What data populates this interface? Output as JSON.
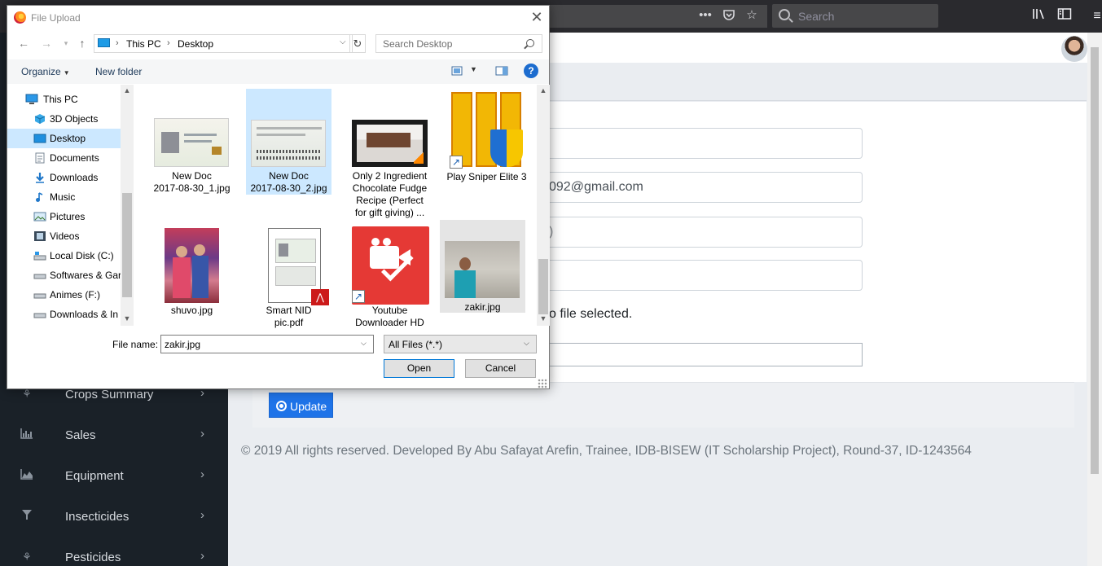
{
  "browser": {
    "search_placeholder": "Search"
  },
  "sidebar": {
    "items": [
      {
        "label": "Crops Summary",
        "icon": "crop-icon"
      },
      {
        "label": "Sales",
        "icon": "bar-chart-icon"
      },
      {
        "label": "Equipment",
        "icon": "area-chart-icon"
      },
      {
        "label": "Insecticides",
        "icon": "filter-icon"
      },
      {
        "label": "Pesticides",
        "icon": "crop-icon"
      }
    ],
    "chevron": "›"
  },
  "form": {
    "email_partial": "092@gmail.com",
    "third_partial": ")",
    "no_file_text": "o file selected.",
    "update_label": "Update"
  },
  "footer": {
    "copyright": "© 2019 All rights reserved. Developed By Abu Safayat Arefin, Trainee, IDB-BISEW (IT Scholarship Project), Round-37, ID-1243564"
  },
  "dialog": {
    "title": "File Upload",
    "path": [
      "This PC",
      "Desktop"
    ],
    "search_placeholder": "Search Desktop",
    "organize_label": "Organize",
    "new_folder_label": "New folder",
    "help_glyph": "?",
    "nav_items": [
      {
        "label": "This PC",
        "icon": "computer-icon"
      },
      {
        "label": "3D Objects",
        "icon": "cube-icon"
      },
      {
        "label": "Desktop",
        "icon": "desktop-icon",
        "selected": true
      },
      {
        "label": "Documents",
        "icon": "document-icon"
      },
      {
        "label": "Downloads",
        "icon": "download-icon"
      },
      {
        "label": "Music",
        "icon": "music-icon"
      },
      {
        "label": "Pictures",
        "icon": "pictures-icon"
      },
      {
        "label": "Videos",
        "icon": "video-icon"
      },
      {
        "label": "Local Disk (C:)",
        "icon": "drive-icon"
      },
      {
        "label": "Softwares & Gar",
        "icon": "drive-icon"
      },
      {
        "label": "Animes (F:)",
        "icon": "drive-icon"
      },
      {
        "label": "Downloads & In",
        "icon": "drive-icon"
      }
    ],
    "files": [
      {
        "label": "New Doc 2017-08-30_1.jpg",
        "lines": [
          "New Doc",
          "2017-08-30_1.jpg"
        ],
        "kind": "id-card"
      },
      {
        "label": "New Doc 2017-08-30_2.jpg",
        "lines": [
          "New Doc",
          "2017-08-30_2.jpg"
        ],
        "kind": "id-card-back",
        "selected": true
      },
      {
        "label": "Only 2 Ingredient Chocolate Fudge Recipe (Perfect for gift giving) ...",
        "lines": [
          "Only 2 Ingredient",
          "Chocolate Fudge",
          "Recipe (Perfect",
          "for gift giving) ..."
        ],
        "kind": "video"
      },
      {
        "label": "Play Sniper Elite 3",
        "lines": [
          "Play Sniper Elite 3"
        ],
        "kind": "game-shortcut"
      },
      {
        "label": "shuvo.jpg",
        "lines": [
          "shuvo.jpg"
        ],
        "kind": "photo-wedding"
      },
      {
        "label": "Smart NID pic.pdf",
        "lines": [
          "Smart NID",
          "pic.pdf"
        ],
        "kind": "pdf"
      },
      {
        "label": "Youtube Downloader HD",
        "lines": [
          "Youtube",
          "Downloader HD"
        ],
        "kind": "app-shortcut"
      },
      {
        "label": "zakir.jpg",
        "lines": [
          "zakir.jpg"
        ],
        "kind": "photo-beach",
        "hover": true
      }
    ],
    "file_name_label": "File name:",
    "file_name_value": "zakir.jpg",
    "file_type_value": "All Files (*.*)",
    "open_label": "Open",
    "cancel_label": "Cancel"
  }
}
